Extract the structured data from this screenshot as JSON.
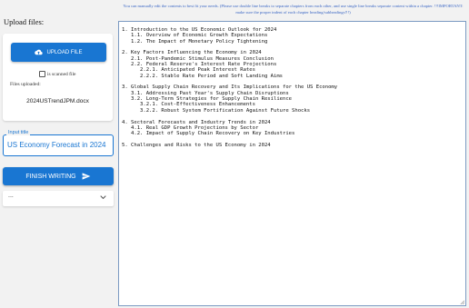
{
  "sidebar": {
    "upload_title": "Upload files:",
    "upload_button": "UPLOAD FILE",
    "scanned_label": "is scanned file",
    "files_uploaded_label": "Files uploaded:",
    "uploaded_file": "2024USTrendJPM.docx",
    "input_title_label": "Input title",
    "input_title_value": "US Economy Forecast in 2024",
    "finish_button": "FINISH WRITING",
    "dropdown_value": "..."
  },
  "editor": {
    "notice": "You can manually edit the contents to best fit your needs. (Please use double line breaks to separate chapters from each other, and use single line breaks separate content within a chapter. !!!IMPORTANT: make sure the proper indent of each chapter heading/subheadings!!!)",
    "outline": [
      "1. Introduction to the US Economic Outlook for 2024",
      "   1.1. Overview of Economic Growth Expectations",
      "   1.2. The Impact of Monetary Policy Tightening",
      "",
      "2. Key Factors Influencing the Economy in 2024",
      "   2.1. Post-Pandemic Stimulus Measures Conclusion",
      "   2.2. Federal Reserve's Interest Rate Projections",
      "      2.2.1. Anticipated Peak Interest Rates",
      "      2.2.2. Stable Rate Period and Soft Landing Aims",
      "",
      "3. Global Supply Chain Recovery and Its Implications for the US Economy",
      "   3.1. Addressing Past Year's Supply Chain Disruptions",
      "   3.2. Long-Term Strategies for Supply Chain Resilience",
      "      3.2.1. Cost-Effectiveness Enhancements",
      "      3.2.2. Robust System Fortification Against Future Shocks",
      "",
      "4. Sectoral Forecasts and Industry Trends in 2024",
      "   4.1. Real GDP Growth Projections by Sector",
      "   4.2. Impact of Supply Chain Recovery on Key Industries",
      "",
      "5. Challenges and Risks to the US Economy in 2024"
    ]
  },
  "icons": {
    "upload": "cloud-upload-icon",
    "send": "send-icon",
    "dropdown": "chevron-down-icon"
  },
  "colors": {
    "accent": "#1976d2",
    "notice_text": "#3a66c4",
    "editor_border": "#7b9ac2"
  }
}
